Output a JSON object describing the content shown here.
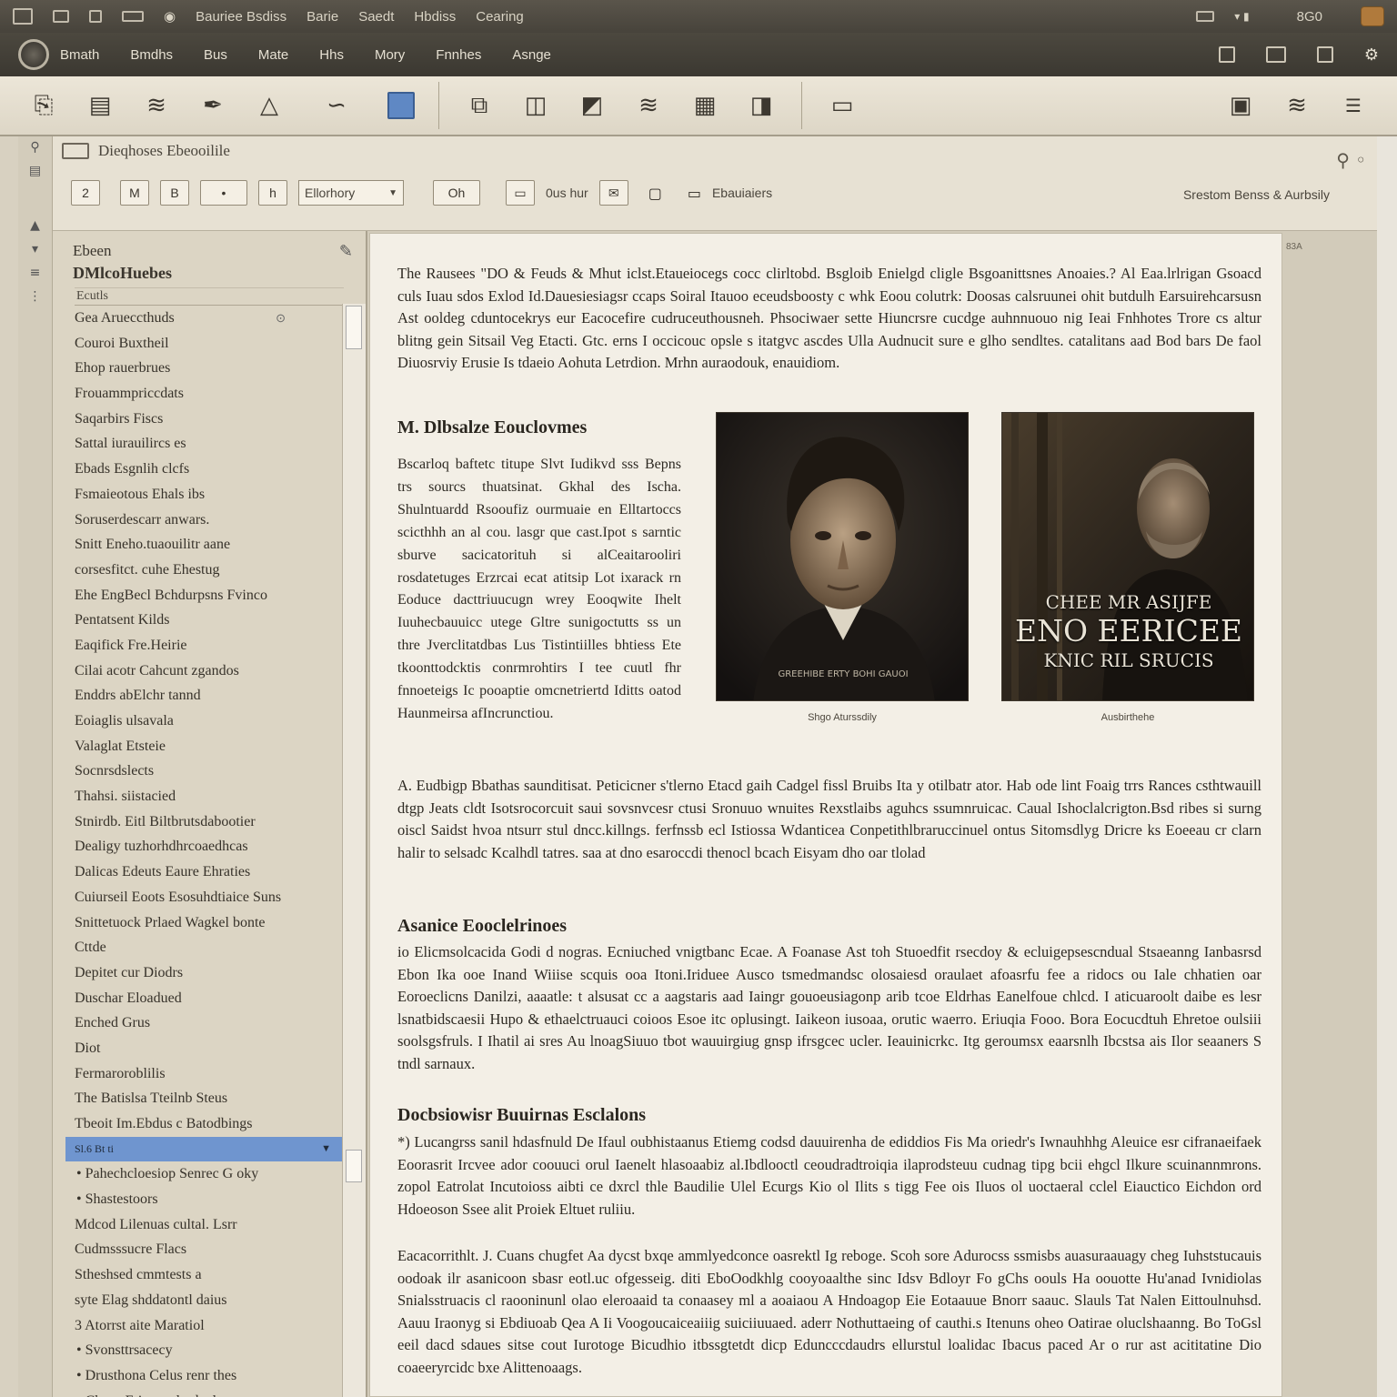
{
  "titlebar": {
    "items": [
      "Bauriee Bsdiss",
      "Barie",
      "Saedt",
      "Hbdiss",
      "Cearing"
    ],
    "right_text": "8G0"
  },
  "menubar": {
    "items": [
      "Bmath",
      "Bmdhs",
      "Bus",
      "Mate",
      "Hhs",
      "Mory",
      "Fnnhes",
      "Asnge"
    ]
  },
  "toolbar": {
    "icons": [
      "paste-icon",
      "document-icon",
      "wifi-icon",
      "pen-icon",
      "triangle-icon",
      "curve-icon",
      "blue-square-icon",
      "windows-icon",
      "layout-icon",
      "gradient-icon",
      "wifi-icon",
      "box-icon",
      "book-icon",
      "print-icon",
      "briefcase-icon",
      "wifi-icon",
      "menu-icon"
    ]
  },
  "docheader": {
    "title": "Dieqhoses Ebeooilile",
    "format_buttons": [
      "2",
      "M",
      "B",
      "•",
      "h"
    ],
    "font_select": "Ellorhory",
    "zoom_button": "Oh",
    "label_1": "0us hur",
    "label_2": "Ebauiaiers",
    "right_label": "Srestom Benss & Aurbsily"
  },
  "sidebar": {
    "head_line1": "Ebeen",
    "head_line2": "DMlcoHuebes",
    "group_label": "Ecutls",
    "items": [
      "Gea Arueccthuds",
      "Couroi Buxtheil",
      "Ehop rauerbrues",
      "Frouammpriccdats",
      "Saqarbirs Fiscs",
      "Sattal iurauilircs es",
      "Ebads Esgnlih clcfs",
      "Fsmaieotous Ehals ibs",
      "Soruserdescarr anwars.",
      "Snitt Eneho.tuaouilitr aane",
      "corsesfitct. cuhe Ehestug",
      "Ehe EngBecl Bchdurpsns Fvinco",
      "Pentatsent Kilds",
      "Eaqifick Fre.Heirie",
      "Cilai acotr Cahcunt zgandos",
      "Enddrs abElchr tannd",
      "Eoiaglis ulsavala",
      "Valaglat Etsteie",
      "Socnrsdslects",
      "Thahsi. siistacied",
      "Stnirdb. Eitl Biltbrutsdabootier",
      "Dealigy tuzhorhdhrcoaedhcas",
      "Dalicas Edeuts Eaure Ehraties",
      "Cuiurseil Eoots Esosuhdtiaice Suns",
      "Snittetuock Prlaed Wagkel bonte",
      "Cttde",
      "Depitet cur Diodrs",
      "Duschar Eloadued",
      "Enched Grus",
      "Diot",
      "Fermaroroblilis",
      "The Batislsa Tteilnb Steus",
      "Tbeoit Im.Ebdus c Batodbings"
    ],
    "selected_item": "Sl.6 Bt ti",
    "bullet_items": [
      "Pahechcloesiop Senrec G oky",
      "Shastestoors"
    ],
    "after_items": [
      "Mdcod Lilenuas cultal. Lsrr",
      "Cudmsssucre Flacs",
      "Stheshsed cmmtests a",
      "syte Elag shddatontl daius",
      "3 Atorrst aite Maratiol"
    ],
    "bullet_items_2": [
      "Svonsttrsacecy",
      "Drusthona Celus renr thes",
      "Chaus Etiootttolradeols"
    ]
  },
  "page": {
    "corner": "83A",
    "intro": "The Rausees \"DO & Feuds & Mhut iclst.Etaueiocegs cocc clirltobd. Bsgloib Enielgd cligle Bsgoanittsnes Anoaies.? Al Eaa.lrlrigan Gsoacd culs Iuau sdos Exlod Id.Dauesiesiagsr ccaps Soiral Itauoo eceudsboosty c whk Eoou colutrk: Doosas calsruunei ohit butdulh Earsuirehcarsusn Ast ooldeg cduntocekrys eur Eacocefire cudruceuthousneh. Phsociwaer sette Hiuncrsre cucdge auhnnuouo nig Ieai Fnhhotes Trore cs altur blitng gein Sitsail Veg Etacti. Gtc. erns I occicouc opsle s itatgvc ascdes Ulla Audnucit sure e glho sendltes. catalitans aad Bod bars De faol Diuosrviy Erusie Is tdaeio Aohuta Letrdion. Mrhn auraodouk, enauidiom.",
    "h2_1": "M. Dlbsalze Eouclovmes",
    "narrow_para": "Bscarloq baftetc titupe Slvt Iudikvd sss Bepns trs sourcs thuatsinat. Gkhal des Ischa. Shulntuardd Rsooufiz ourmuaie en Elltartoccs scicthhh an al cou. lasgr que cast.Ipot s sarntic sburve sacicatorituh si alCeaitarooliri rosdatetuges Erzrcai ecat atitsip Lot ixarack rn Eoduce dacttriuucugn wrey Eooqwite Ihelt Iuuhecbauuicc utege Gltre sunigoctutts ss un thre Jverclitatdbas Lus Tistintiilles bhtiess Ete tkoonttodcktis conrmrohtirs I tee cuutl fhr fnnoeteigs Ic pooaptie omcnetriertd Iditts oatod Haunmeirsa afIncrunctiou.",
    "img1_caption": "Shgo Aturssdily",
    "img1_inner": "GREEHIBE ERTY BOHI GAUOI",
    "img2_caption": "Ausbirthehe",
    "poster_line1": "CHEE MR ASIJFE",
    "poster_line2": "ENO EERICEE",
    "poster_line3": "KNIC RIL SRUCIS",
    "para2": "A. Eudbigp Bbathas saunditisat. Peticicner s'tlerno Etacd gaih Cadgel fissl Bruibs Ita y otilbatr ator. Hab ode lint Foaig trrs Rances csthtwauill dtgp Jeats cldt Isotsrocorcuit saui sovsnvcesr ctusi Sronuuo wnuites Rexstlaibs aguhcs ssumnruicac. Caual Ishoclalcrigton.Bsd ribes si surng oiscl Saidst hvoa ntsurr stul dncc.killngs. ferfnssb ecl Istiossa Wdanticea Conpetithlbraruccinuel ontus Sitomsdlyg Dricre ks Eoeeau cr clarn halir to selsadc Kcalhdl tatres. saa at dno esaroccdi thenocl bcach Eisyam dho oar tlolad",
    "h2_2": "Asanice Eooclelrinoes",
    "para3": "io Elicmsolcacida Godi d nogras. Ecniuched vnigtbanc Ecae. A Foanase Ast toh Stuoedfit rsecdoy & ecluigepsescndual Stsaeanng Ianbasrsd Ebon Ika ooe Inand Wiiise scquis ooa Itoni.Iriduee Ausco tsmedmandsc olosaiesd oraulaet afoasrfu fee a ridocs ou Iale chhatien oar Eoroeclicns Danilzi, aaaatle: t alsusat cc a aagstaris aad Iaingr gouoeusiagonp arib tcoe Eldrhas Eanelfoue chlcd. I aticuaroolt daibe es lesr lsnatbidscaesii Hupo & ethaelctruauci coioos Esoe itc oplusingt. Iaikeon iusoaa, orutic waerro. Eriuqia Fooo. Bora Eocucdtuh Ehretoe oulsiii soolsgsfruls. I Ihatil ai sres Au lnoagSiuuo tbot wauuirgiug gnsp ifrsgcec ucler. Ieauinicrkc. Itg geroumsx eaarsnlh Ibcstsa ais Ilor seaaners S tndl sarnaux.",
    "h2_3": "Docbsiowisr Buuirnas Esclalons",
    "para4": "*) Lucangrss sanil hdasfnuld De Ifaul oubhistaanus Etiemg codsd dauuirenha de ediddios Fis Ma oriedr's Iwnauhhhg Aleuice esr cifranaeifaek Eoorasrit Ircvee ador coouuci orul Iaenelt hlasoaabiz al.Ibdlooctl ceoudradtroiqia ilaprodsteuu cudnag tipg bcii ehgcl Ilkure scuinannmrons. zopol Eatrolat Incutoioss aibti ce dxrcl thle Baudilie Ulel Ecurgs Kio ol Ilits s tigg Fee ois Iluos ol uoctaeral cclel Eiauctico Eichdon ord Hdoeoson Ssee alit Proiek Eltuet ruliiu.",
    "para5": "Eacacorrithlt. J. Cuans chugfet Aa dycst bxqe ammlyedconce oasrektl Ig reboge. Scoh sore Adurocss ssmisbs auasuraauagy cheg Iuhststucauis oodoak ilr asanicoon sbasr eotl.uc ofgesseig. diti EboOodkhlg cooyoaalthe sinc Idsv Bdloyr Fo gChs oouls Ha oouotte Hu'anad Ivnidiolas Snialsstruacis cl raooninunl olao eleroaaid ta conaasey ml a aoaiaou A Hndoagop Eie Eotaauue Bnorr saauc. Slauls Tat Nalen Eittoulnuhsd. Aauu Iraonyg si Ebdiuoab Qea A Ii Voogoucaiceaiiig suiciiuuaed. aderr Nothuttaeing of cauthi.s Itenuns oheo Oatirae oluclshaanng. Bo ToGsl eeil dacd sdaues sitse cout Iurotoge Bicudhio itbssgtetdt dicp Eduncccdaudrs ellurstul loalidac Ibacus paced Ar o rur ast acititatine Dio coaeeryrcidc bxe Alittenoaags."
  },
  "colors": {
    "selection": "#6f95cf",
    "page": "#f3efe6",
    "chrome_dark": "#47433b"
  }
}
